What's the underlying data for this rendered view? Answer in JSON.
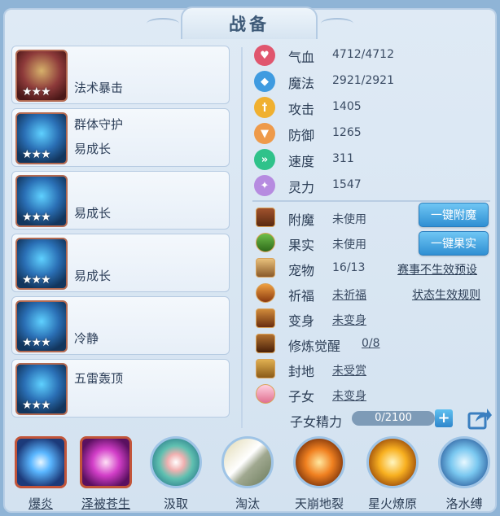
{
  "title": "战备",
  "equipment": [
    {
      "line1": "",
      "line2": "法术暴击",
      "stars": "★★★"
    },
    {
      "line1": "群体守护",
      "line2": "易成长",
      "stars": "★★★"
    },
    {
      "line1": "",
      "line2": "易成长",
      "stars": "★★★"
    },
    {
      "line1": "",
      "line2": "易成长",
      "stars": "★★★"
    },
    {
      "line1": "",
      "line2": "冷静",
      "stars": "★★★"
    },
    {
      "line1": "五雷轰顶",
      "line2": "",
      "stars": "★★★"
    }
  ],
  "stats": [
    {
      "icon": "heart-icon",
      "name": "气血",
      "value": "4712/4712",
      "color": "#e0566e"
    },
    {
      "icon": "mana-icon",
      "name": "魔法",
      "value": "2921/2921",
      "color": "#3f9be0"
    },
    {
      "icon": "attack-icon",
      "name": "攻击",
      "value": "1405",
      "color": "#f0b030"
    },
    {
      "icon": "defense-icon",
      "name": "防御",
      "value": "1265",
      "color": "#ee9a4a"
    },
    {
      "icon": "speed-icon",
      "name": "速度",
      "value": "311",
      "color": "#2fc28a"
    },
    {
      "icon": "spirit-icon",
      "name": "灵力",
      "value": "1547",
      "color": "#b68be0"
    }
  ],
  "misc": [
    {
      "icon": "enchant-icon",
      "name": "附魔",
      "value": "未使用"
    },
    {
      "icon": "fruit-icon",
      "name": "果实",
      "value": "未使用"
    },
    {
      "icon": "pet-icon",
      "name": "宠物",
      "value": "16/13"
    },
    {
      "icon": "blessing-icon",
      "name": "祈福",
      "value": "未祈福"
    },
    {
      "icon": "transform-icon",
      "name": "变身",
      "value": "未变身"
    },
    {
      "icon": "cultivation-icon",
      "name": "修炼觉醒",
      "value": "0/8"
    },
    {
      "icon": "fief-icon",
      "name": "封地",
      "value": "未受赏"
    },
    {
      "icon": "child-icon",
      "name": "子女",
      "value": "未变身"
    }
  ],
  "buttons": {
    "enchant": "一键附魔",
    "fruit": "一键果实"
  },
  "links": {
    "event_preset": "赛事不生效预设",
    "status_rules": "状态生效规则"
  },
  "energy": {
    "label": "子女精力",
    "value": "0/2100",
    "fraction": 0.0
  },
  "skills": [
    {
      "icon": "explosion-flame-icon",
      "label": "爆炎",
      "underlined": true,
      "style": "square"
    },
    {
      "icon": "blessing-palm-icon",
      "label": "泽被苍生",
      "underlined": true,
      "style": "square"
    },
    {
      "icon": "absorb-icon",
      "label": "汲取",
      "underlined": false,
      "style": "round"
    },
    {
      "icon": "eliminate-icon",
      "label": "淘汰",
      "underlined": false,
      "style": "round"
    },
    {
      "icon": "earthquake-icon",
      "label": "天崩地裂",
      "underlined": false,
      "style": "round"
    },
    {
      "icon": "wildfire-icon",
      "label": "星火燎原",
      "underlined": false,
      "style": "round"
    },
    {
      "icon": "water-bind-icon",
      "label": "洛水缚",
      "underlined": false,
      "style": "round"
    }
  ]
}
